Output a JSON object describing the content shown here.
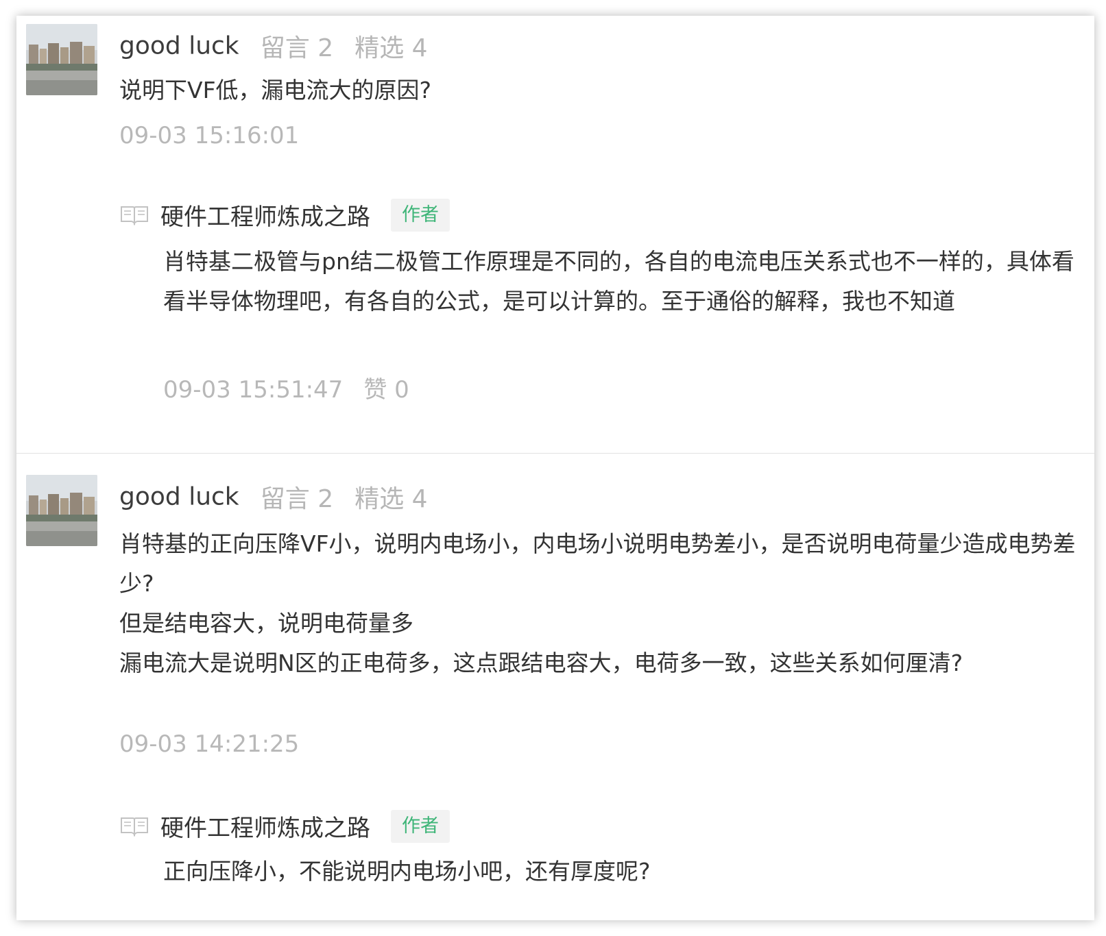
{
  "comments": [
    {
      "user": {
        "name": "good luck",
        "messages": "留言 2",
        "featured": "精选 4"
      },
      "content": "说明下VF低，漏电流大的原因?",
      "time": "09-03 15:16:01",
      "reply": {
        "author": "硬件工程师炼成之路",
        "badge": "作者",
        "content": "肖特基二极管与pn结二极管工作原理是不同的，各自的电流电压关系式也不一样的，具体看看半导体物理吧，有各自的公式，是可以计算的。至于通俗的解释，我也不知道",
        "time": "09-03 15:51:47",
        "likes": "赞 0"
      }
    },
    {
      "user": {
        "name": "good luck",
        "messages": "留言 2",
        "featured": "精选 4"
      },
      "content_lines": [
        "肖特基的正向压降VF小，说明内电场小，内电场小说明电势差小，是否说明电荷量少造成电势差少?",
        "但是结电容大，说明电荷量多",
        "漏电流大是说明N区的正电荷多，这点跟结电容大，电荷多一致，这些关系如何厘清?"
      ],
      "time": "09-03 14:21:25",
      "reply": {
        "author": "硬件工程师炼成之路",
        "badge": "作者",
        "content": "正向压降小，不能说明内电场小吧，还有厚度呢?"
      }
    }
  ],
  "icons": {
    "avatar": "avatar-photo",
    "reply_marker": "book-icon"
  },
  "colors": {
    "badge_text": "#3fb578",
    "badge_bg": "#f2f2f2",
    "meta_text": "#b6b6b6",
    "body_text": "#333333"
  }
}
